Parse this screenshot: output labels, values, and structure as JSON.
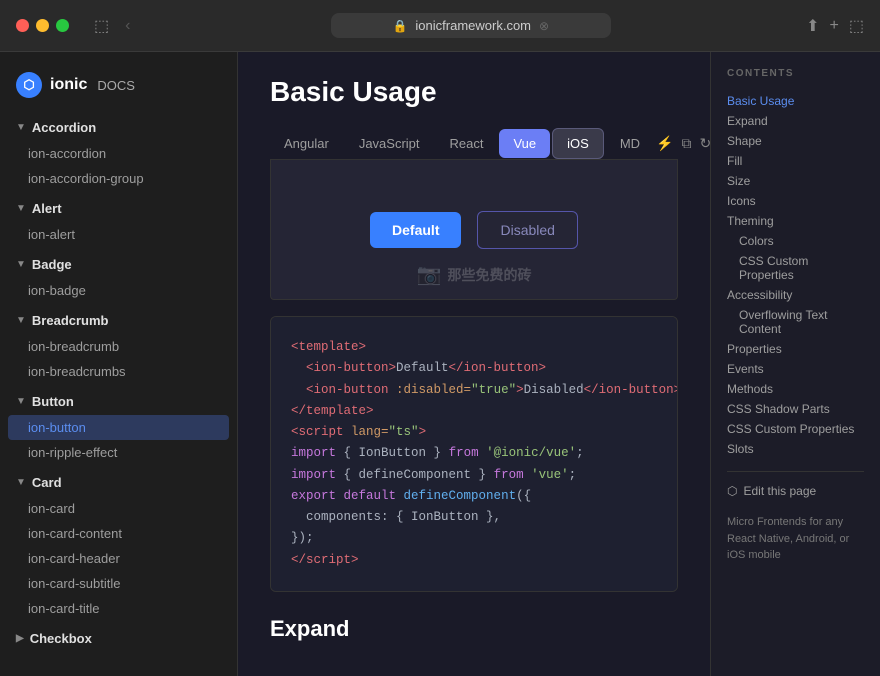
{
  "titlebar": {
    "url": "ionicframework.com",
    "back_btn": "‹",
    "forward_btn": "›"
  },
  "brand": {
    "name": "ionic",
    "docs": "DOCS",
    "logo_text": "i"
  },
  "sidebar": {
    "sections": [
      {
        "label": "Accordion",
        "items": [
          "ion-accordion",
          "ion-accordion-group"
        ]
      },
      {
        "label": "Alert",
        "items": [
          "ion-alert"
        ]
      },
      {
        "label": "Badge",
        "items": [
          "ion-badge"
        ]
      },
      {
        "label": "Breadcrumb",
        "items": [
          "ion-breadcrumb",
          "ion-breadcrumbs"
        ]
      },
      {
        "label": "Button",
        "items": [
          "ion-button",
          "ion-ripple-effect"
        ],
        "active_item": "ion-button"
      },
      {
        "label": "Card",
        "items": [
          "ion-card",
          "ion-card-content",
          "ion-card-header",
          "ion-card-subtitle",
          "ion-card-title"
        ]
      },
      {
        "label": "Checkbox",
        "items": []
      }
    ]
  },
  "tabs": {
    "items": [
      "Angular",
      "JavaScript",
      "React",
      "Vue",
      "iOS",
      "MD"
    ],
    "active_vue": "Vue",
    "active_ios": "iOS"
  },
  "preview": {
    "default_btn": "Default",
    "disabled_btn": "Disabled"
  },
  "code": {
    "lines": [
      "<template>",
      "  <ion-button>Default</ion-button>",
      "  <ion-button :disabled=\"true\">Disabled</ion-button>",
      "</template>",
      "",
      "<script lang=\"ts\">",
      "import { IonButton } from '@ionic/vue';",
      "import { defineComponent } from 'vue';",
      "",
      "export default defineComponent({",
      "  components: { IonButton },",
      "});"
    ]
  },
  "toc": {
    "heading": "CONTENTS",
    "items": [
      {
        "label": "Basic Usage",
        "active": true,
        "indent": false
      },
      {
        "label": "Expand",
        "active": false,
        "indent": false
      },
      {
        "label": "Shape",
        "active": false,
        "indent": false
      },
      {
        "label": "Fill",
        "active": false,
        "indent": false
      },
      {
        "label": "Size",
        "active": false,
        "indent": false
      },
      {
        "label": "Icons",
        "active": false,
        "indent": false
      },
      {
        "label": "Theming",
        "active": false,
        "indent": false
      },
      {
        "label": "Colors",
        "active": false,
        "indent": true
      },
      {
        "label": "CSS Custom Properties",
        "active": false,
        "indent": true
      },
      {
        "label": "Accessibility",
        "active": false,
        "indent": false
      },
      {
        "label": "Overflowing Text Content",
        "active": false,
        "indent": true
      },
      {
        "label": "Properties",
        "active": false,
        "indent": false
      },
      {
        "label": "Events",
        "active": false,
        "indent": false
      },
      {
        "label": "Methods",
        "active": false,
        "indent": false
      },
      {
        "label": "CSS Shadow Parts",
        "active": false,
        "indent": false
      },
      {
        "label": "CSS Custom Properties",
        "active": false,
        "indent": false
      },
      {
        "label": "Slots",
        "active": false,
        "indent": false
      }
    ],
    "edit_page": "Edit this page"
  },
  "page": {
    "title": "Basic Usage",
    "expand_title": "Expand"
  },
  "ad": {
    "text": "Micro Frontends for any React Native, Android, or iOS mobile"
  }
}
